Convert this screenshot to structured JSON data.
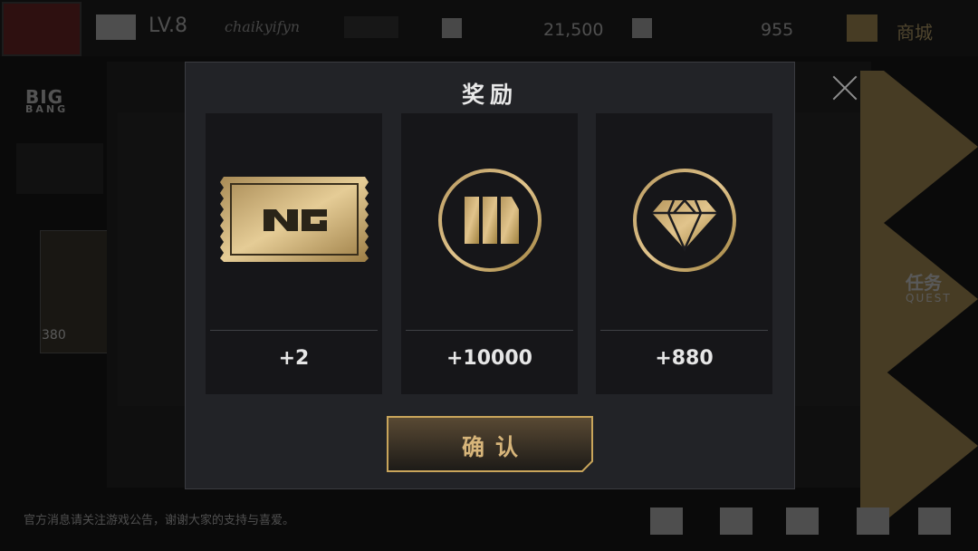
{
  "background": {
    "level": "LV.8",
    "player_name": "chaikyifyn",
    "coins": "21,500",
    "gems": "955",
    "shop_label": "商城",
    "brand_logo": "BIG",
    "brand_logo_sub": "BANG",
    "card_price": "380",
    "quest_label": "任务",
    "quest_sub": "QUEST",
    "news_text": "官方消息请关注游戏公告，谢谢大家的支持与喜爱。"
  },
  "modal": {
    "title": "奖励",
    "close_icon": "close-icon",
    "rewards": [
      {
        "icon": "ticket-icon",
        "amount": "+2"
      },
      {
        "icon": "coin-icon",
        "amount": "+10000"
      },
      {
        "icon": "diamond-icon",
        "amount": "+880"
      }
    ],
    "confirm_label": "确认"
  },
  "colors": {
    "gold": "#c9a55b",
    "modal_bg": "#222327",
    "card_bg": "#161619",
    "text": "#e6e6e6"
  }
}
